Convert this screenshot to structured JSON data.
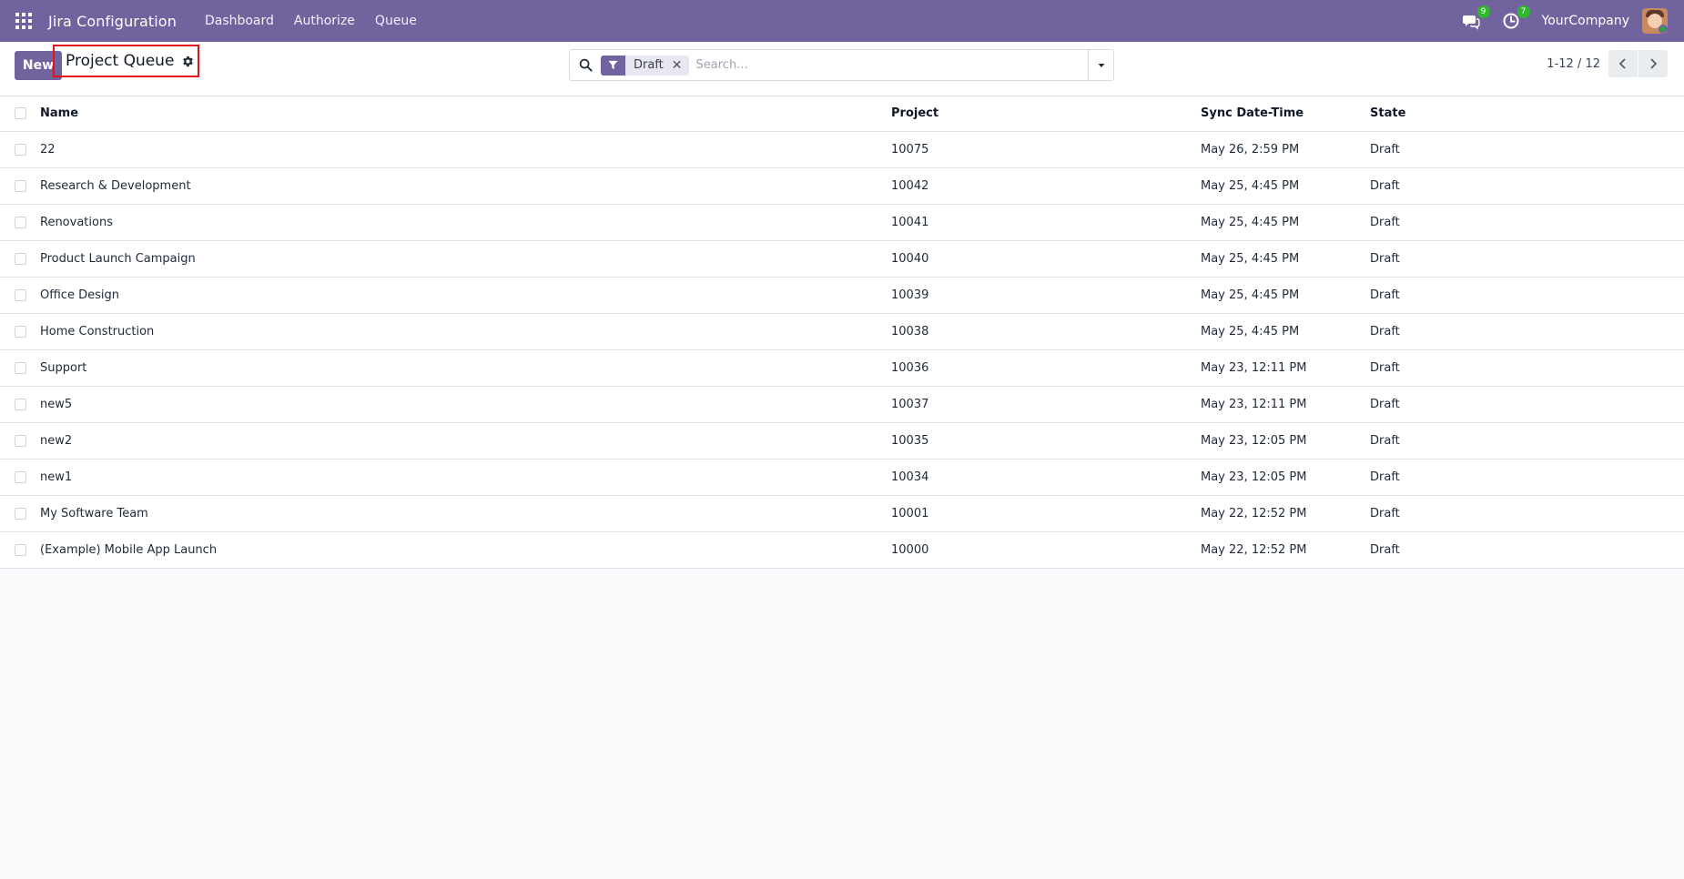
{
  "navbar": {
    "app_title": "Jira Configuration",
    "menu": [
      "Dashboard",
      "Authorize",
      "Queue"
    ],
    "messages_count": "9",
    "activities_count": "7",
    "company": "YourCompany"
  },
  "control_panel": {
    "new_label": "New",
    "breadcrumb": "Project Queue",
    "search": {
      "facet_label": "Draft",
      "facet_remove": "✕",
      "placeholder": "Search..."
    },
    "pager": "1-12 / 12"
  },
  "table": {
    "headers": {
      "name": "Name",
      "project": "Project",
      "sync": "Sync Date-Time",
      "state": "State"
    },
    "rows": [
      {
        "name": "22",
        "project": "10075",
        "sync": "May 26, 2:59 PM",
        "state": "Draft"
      },
      {
        "name": "Research & Development",
        "project": "10042",
        "sync": "May 25, 4:45 PM",
        "state": "Draft"
      },
      {
        "name": "Renovations",
        "project": "10041",
        "sync": "May 25, 4:45 PM",
        "state": "Draft"
      },
      {
        "name": "Product Launch Campaign",
        "project": "10040",
        "sync": "May 25, 4:45 PM",
        "state": "Draft"
      },
      {
        "name": "Office Design",
        "project": "10039",
        "sync": "May 25, 4:45 PM",
        "state": "Draft"
      },
      {
        "name": "Home Construction",
        "project": "10038",
        "sync": "May 25, 4:45 PM",
        "state": "Draft"
      },
      {
        "name": "Support",
        "project": "10036",
        "sync": "May 23, 12:11 PM",
        "state": "Draft"
      },
      {
        "name": "new5",
        "project": "10037",
        "sync": "May 23, 12:11 PM",
        "state": "Draft"
      },
      {
        "name": "new2",
        "project": "10035",
        "sync": "May 23, 12:05 PM",
        "state": "Draft"
      },
      {
        "name": "new1",
        "project": "10034",
        "sync": "May 23, 12:05 PM",
        "state": "Draft"
      },
      {
        "name": "My Software Team",
        "project": "10001",
        "sync": "May 22, 12:52 PM",
        "state": "Draft"
      },
      {
        "name": "(Example) Mobile App Launch",
        "project": "10000",
        "sync": "May 22, 12:52 PM",
        "state": "Draft"
      }
    ]
  },
  "colors": {
    "brand": "#71639e",
    "badge": "#2eb82e",
    "highlight_border": "#e0151b"
  },
  "icons": [
    "apps-grid-icon",
    "chat-icon",
    "clock-icon",
    "gear-icon",
    "search-icon",
    "filter-icon",
    "caret-down-icon",
    "chevron-left-icon",
    "chevron-right-icon"
  ]
}
